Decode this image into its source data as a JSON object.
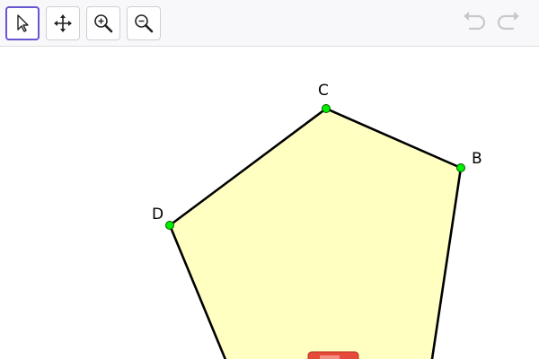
{
  "toolbar": {
    "tools": [
      {
        "name": "move-tool",
        "icon": "cursor-arrow-icon",
        "selected": true
      },
      {
        "name": "move-graphics-view-tool",
        "icon": "four-way-arrows-icon",
        "selected": false
      },
      {
        "name": "zoom-in-tool",
        "icon": "zoom-in-icon",
        "selected": false
      },
      {
        "name": "zoom-out-tool",
        "icon": "zoom-out-icon",
        "selected": false
      }
    ],
    "undo_icon": "undo-arrow-icon",
    "redo_icon": "redo-arrow-icon"
  },
  "construction": {
    "polygon_fill": "#ffffc2",
    "polygon_stroke": "#000000",
    "point_color": "#00ee00",
    "points": {
      "B": {
        "label": "B"
      },
      "C": {
        "label": "C"
      },
      "D": {
        "label": "D"
      }
    }
  },
  "colors": {
    "selected_border": "#6557d2",
    "toolbar_bg": "#f8f8fa",
    "disabled_icon": "#c8c8c8"
  }
}
